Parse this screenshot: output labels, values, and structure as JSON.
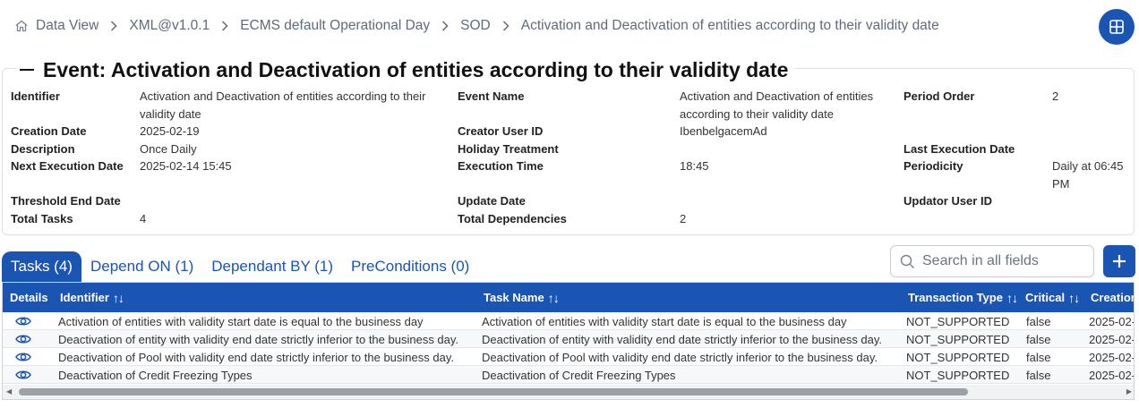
{
  "breadcrumb": {
    "items": [
      "Data View",
      "XML@v1.0.1",
      "ECMS default Operational Day",
      "SOD",
      "Activation and Deactivation of entities according to their validity date"
    ]
  },
  "event": {
    "title": "Event: Activation and Deactivation of entities according to their validity date",
    "fields": {
      "identifier": {
        "label": "Identifier",
        "value": "Activation and Deactivation of entities according to their validity date"
      },
      "event_name": {
        "label": "Event Name",
        "value": "Activation and Deactivation of entities according to their validity date"
      },
      "period_order": {
        "label": "Period Order",
        "value": "2"
      },
      "creation_date": {
        "label": "Creation Date",
        "value": "2025-02-19"
      },
      "creator_user_id": {
        "label": "Creator User ID",
        "value": "IbenbelgacemAd"
      },
      "description": {
        "label": "Description",
        "value": "Once Daily"
      },
      "holiday_treatment": {
        "label": "Holiday Treatment",
        "value": ""
      },
      "last_execution_date": {
        "label": "Last Execution Date",
        "value": ""
      },
      "next_execution_date": {
        "label": "Next Execution Date",
        "value": "2025-02-14 15:45"
      },
      "execution_time": {
        "label": "Execution Time",
        "value": "18:45"
      },
      "periodicity": {
        "label": "Periodicity",
        "value": "Daily at 06:45 PM"
      },
      "threshold_end_date": {
        "label": "Threshold End Date",
        "value": ""
      },
      "update_date": {
        "label": "Update Date",
        "value": ""
      },
      "updator_user_id": {
        "label": "Updator User ID",
        "value": ""
      },
      "total_tasks": {
        "label": "Total Tasks",
        "value": "4"
      },
      "total_dependencies": {
        "label": "Total Dependencies",
        "value": "2"
      }
    }
  },
  "tabs": [
    "Tasks (4)",
    "Depend ON (1)",
    "Dependant BY (1)",
    "PreConditions (0)"
  ],
  "search": {
    "placeholder": "Search in all fields"
  },
  "table": {
    "columns": [
      "Details",
      "Identifier",
      "Task Name",
      "Transaction Type",
      "Critical",
      "Creation"
    ],
    "rows": [
      [
        "Activation of entities with validity start date is equal to the business day",
        "Activation of entities with validity start date is equal to the business day",
        "NOT_SUPPORTED",
        "false",
        "2025-02-"
      ],
      [
        "Deactivation of entity with validity end date strictly inferior to the business day.",
        "Deactivation of entity with validity end date strictly inferior to the business day.",
        "NOT_SUPPORTED",
        "false",
        "2025-02-"
      ],
      [
        "Deactivation of Pool with validity end date strictly inferior to the business day.",
        "Deactivation of Pool with validity end date strictly inferior to the business day.",
        "NOT_SUPPORTED",
        "false",
        "2025-02-"
      ],
      [
        "Deactivation of Credit Freezing Types",
        "Deactivation of Credit Freezing Types",
        "NOT_SUPPORTED",
        "false",
        "2025-02-"
      ]
    ]
  },
  "colors": {
    "primary": "#1b55b4"
  }
}
